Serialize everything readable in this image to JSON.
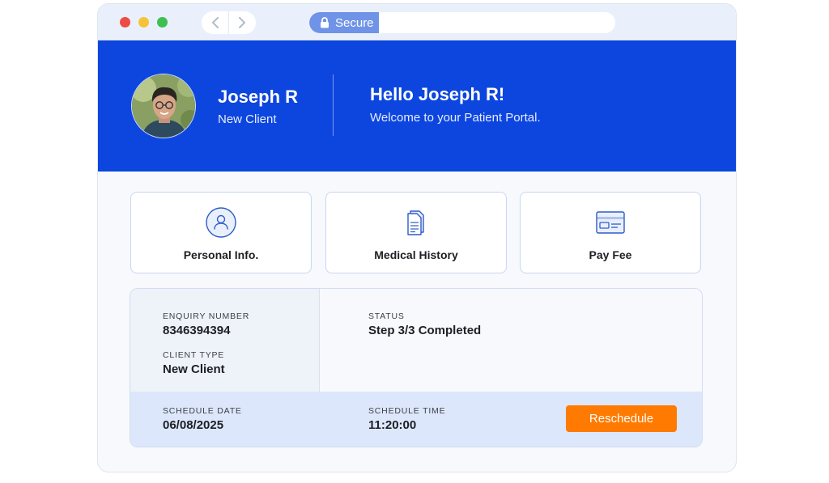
{
  "browser": {
    "secure_label": "Secure",
    "address_value": ""
  },
  "hero": {
    "user_name": "Joseph R",
    "user_role": "New Client",
    "greeting": "Hello Joseph R!",
    "welcome": "Welcome to your Patient Portal."
  },
  "cards": [
    {
      "label": "Personal Info.",
      "icon": "user-icon"
    },
    {
      "label": "Medical History",
      "icon": "document-icon"
    },
    {
      "label": "Pay Fee",
      "icon": "credit-card-icon"
    }
  ],
  "details": {
    "enquiry_label": "ENQUIRY NUMBER",
    "enquiry_value": "8346394394",
    "client_type_label": "CLIENT TYPE",
    "client_type_value": "New Client",
    "status_label": "STATUS",
    "status_value": "Step 3/3 Completed",
    "schedule_date_label": "SCHEDULE DATE",
    "schedule_date_value": "06/08/2025",
    "schedule_time_label": "SCHEDULE TIME",
    "schedule_time_value": "11:20:00",
    "reschedule_label": "Reschedule"
  },
  "colors": {
    "brand_blue": "#0d46df",
    "accent_orange": "#ff7a00",
    "icon_blue": "#2f5cc9"
  }
}
